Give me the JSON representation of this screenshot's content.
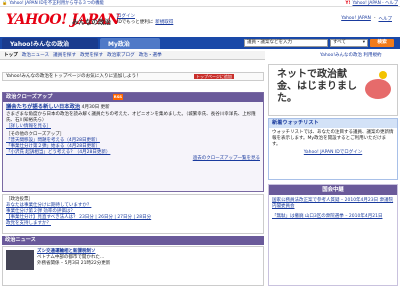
{
  "topbar": {
    "left_text": "Yahoo! JAPAN IDを不正利用から守る３つの機能",
    "right_logo": "Y!",
    "right_text": "Yahoo! JAPAN - ヘルプ"
  },
  "header": {
    "logo": "YAHOO! JAPAN",
    "site_name": "みんなの政治",
    "login_label": "ログイン",
    "login_sub": "IDでもっと便利に",
    "register_label": "新規取得",
    "top_links": [
      "Yahoo! JAPAN",
      "ヘルプ"
    ]
  },
  "nav": {
    "tabs": [
      "Yahoo!みんなの政治",
      "My政治"
    ],
    "search_value": "議員・議案などを入力",
    "search_select": "すべて",
    "search_button": "検索"
  },
  "subnav": {
    "items": [
      "トップ",
      "政治ニュース",
      "議員を探す",
      "政党を探す",
      "政治家ブログ",
      "政治・選挙"
    ],
    "right_links": "Yahoo!みんなの政治 利用規約"
  },
  "notice": {
    "text": "Yahoo!みんなの政治をトップページのお気に入りに追加しよう！",
    "button": "トップページに追加"
  },
  "closeup": {
    "title": "政治クローズアップ",
    "rss": "RSS",
    "headline": "議会たちが語る新しい日本政治",
    "date": "4月30日 更新",
    "body": "さまざまな角度から日本の政治を読み解く議員たちの考えた、オピニオンを集めました。（城繁幸氏、長谷川幸洋氏、上杉隆氏、石川知裕氏ら）",
    "more": "［詳しい情報を見る］",
    "others_label": "［その他のクローズアップ］",
    "items": [
      "「普天間移設」問題を考える（4月28日更新）",
      "「事業仕分け第２弾」始まる（4月28日更新）",
      "「小沢氏 起訴相当」どう考える？（4月28日更新）"
    ],
    "more_link": "過去のクローズアップ一覧を見る"
  },
  "poll": {
    "label": "［政治投票］",
    "items": [
      "あなたは事業仕分けに期待していますか？",
      "事業仕分け第２弾 効率の評価は？",
      "【事業仕分け】見直すべき法人は？ 23日分 | 26日分 | 27日分 | 28日分",
      "政党を支持しますか？"
    ]
  },
  "news": {
    "title": "政治ニュース",
    "headline": "ズシ交通運輸相と新課税制ソ",
    "body": "ベトナム中部の都市で開かれた…",
    "more": "外務省関係 – 5月3日 21時22分更新"
  },
  "right": {
    "ad_title": "ネットで政治献金、はじまりました。",
    "watch_title": "新着ウォッチリスト",
    "watch_body": "ウォッチリストでは、あなたの注目する議員、議案の更新情報を表示します。My政治を開設するとご利用いただけます。",
    "watch_link": "Yahoo! JAPAN IDでログイン",
    "diet_title": "国会中継",
    "diet_items": [
      "国家公務員法改正案で参考人質疑 – 2010年4月23日 衆議院内閣委員会",
      "「無駄」は撤廃 山口3区の衆院選挙 – 2010年4月21日"
    ]
  }
}
